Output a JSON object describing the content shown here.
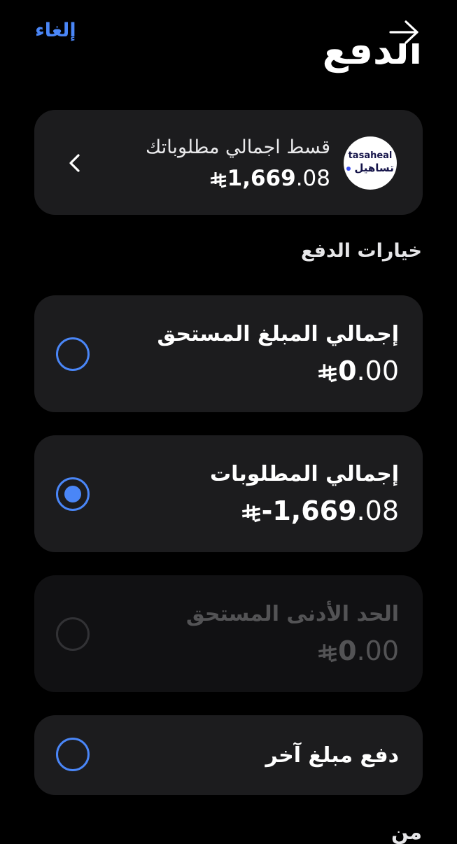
{
  "header": {
    "cancel_label": "إلغاء",
    "back_icon": "arrow-right-icon",
    "title": "الدفع"
  },
  "installment_card": {
    "logo": {
      "text_en": "tasaheal",
      "text_ar": "تساهيل"
    },
    "title": "قسط اجمالي مطلوباتك",
    "amount_int": "1,669",
    "amount_dec": ".08",
    "currency_icon": "saudi-riyal-icon",
    "chevron_icon": "chevron-left-icon"
  },
  "payment_options_label": "خيارات الدفع",
  "options": [
    {
      "title": "إجمالي المبلغ المستحق",
      "amount_int": "0",
      "amount_dec": ".00",
      "selected": false,
      "disabled": false
    },
    {
      "title": "إجمالي المطلوبات",
      "amount_int": "-1,669",
      "amount_dec": ".08",
      "selected": true,
      "disabled": false
    },
    {
      "title": "الحد الأدنى المستحق",
      "amount_int": "0",
      "amount_dec": ".00",
      "selected": false,
      "disabled": true
    },
    {
      "title": "دفع مبلغ آخر",
      "selected": false,
      "disabled": false
    }
  ],
  "footer_label": "من",
  "colors": {
    "accent": "#4a86f7",
    "card": "#1c1c1e",
    "background": "#000000"
  }
}
